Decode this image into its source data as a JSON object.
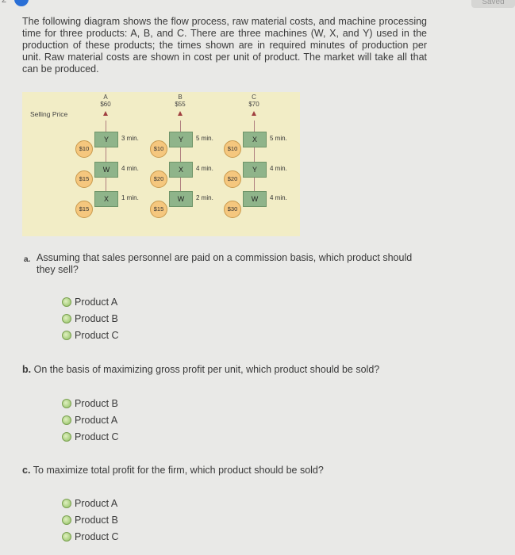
{
  "header": {
    "question_number": "2",
    "saved_label": "Saved"
  },
  "intro": "The following diagram shows the flow process, raw material costs, and machine processing time for three products: A, B, and C. There are three machines (W, X, and Y) used in the production of these products; the times shown are in required minutes of production per unit. Raw material costs are shown in cost per unit of product. The market will take all that can be produced.",
  "diagram": {
    "selling_price_label": "Selling Price",
    "products": [
      {
        "name": "A",
        "price": "$60",
        "steps": [
          {
            "machine": "Y",
            "time": "3 min."
          },
          {
            "machine": "W",
            "time": "4 min."
          },
          {
            "machine": "X",
            "time": "1 min."
          }
        ],
        "materials": [
          "$10",
          "$15",
          "$15"
        ]
      },
      {
        "name": "B",
        "price": "$55",
        "steps": [
          {
            "machine": "Y",
            "time": "5 min."
          },
          {
            "machine": "X",
            "time": "4 min."
          },
          {
            "machine": "W",
            "time": "2 min."
          }
        ],
        "materials": [
          "$10",
          "$20",
          "$15"
        ]
      },
      {
        "name": "C",
        "price": "$70",
        "steps": [
          {
            "machine": "X",
            "time": "5 min."
          },
          {
            "machine": "Y",
            "time": "4 min."
          },
          {
            "machine": "W",
            "time": "4 min."
          }
        ],
        "materials": [
          "$10",
          "$20",
          "$30"
        ]
      }
    ]
  },
  "questions": [
    {
      "marker": "a.",
      "text": "Assuming that sales personnel are paid on a commission basis, which product should they sell?",
      "options": [
        "Product A",
        "Product B",
        "Product C"
      ]
    },
    {
      "marker": "b.",
      "text": "On the basis of maximizing gross profit per unit, which product should be sold?",
      "options": [
        "Product B",
        "Product A",
        "Product C"
      ]
    },
    {
      "marker": "c.",
      "text": "To maximize total profit for the firm, which product should be sold?",
      "options": [
        "Product A",
        "Product B",
        "Product C"
      ]
    }
  ]
}
